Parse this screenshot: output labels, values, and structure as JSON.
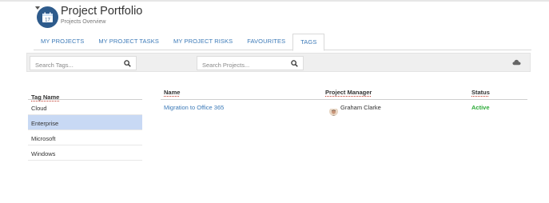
{
  "header": {
    "title": "Project Portfolio",
    "subtitle": "Projects Overview"
  },
  "tabs": [
    {
      "label": "MY PROJECTS",
      "active": false
    },
    {
      "label": "MY PROJECT TASKS",
      "active": false
    },
    {
      "label": "MY PROJECT RISKS",
      "active": false
    },
    {
      "label": "FAVOURITES",
      "active": false
    },
    {
      "label": "TAGS",
      "active": true
    }
  ],
  "search": {
    "tags_placeholder": "Search Tags...",
    "projects_placeholder": "Search Projects..."
  },
  "tag_table": {
    "header": "Tag Name",
    "rows": [
      "Cloud",
      "Enterprise",
      "Microsoft",
      "Windows"
    ],
    "selected": "Enterprise"
  },
  "project_table": {
    "headers": {
      "name": "Name",
      "manager": "Project Manager",
      "status": "Status"
    },
    "rows": [
      {
        "name": "Migration to Office 365",
        "manager": "Graham Clarke",
        "status": "Active"
      }
    ]
  },
  "colors": {
    "accent": "#3c7ab8",
    "status_active": "#2eab3a",
    "selection": "#c8d9f4",
    "app_icon": "#2e5b8c"
  },
  "icons": [
    "app-calendar-icon",
    "search-icon",
    "cloud-icon",
    "avatar"
  ]
}
